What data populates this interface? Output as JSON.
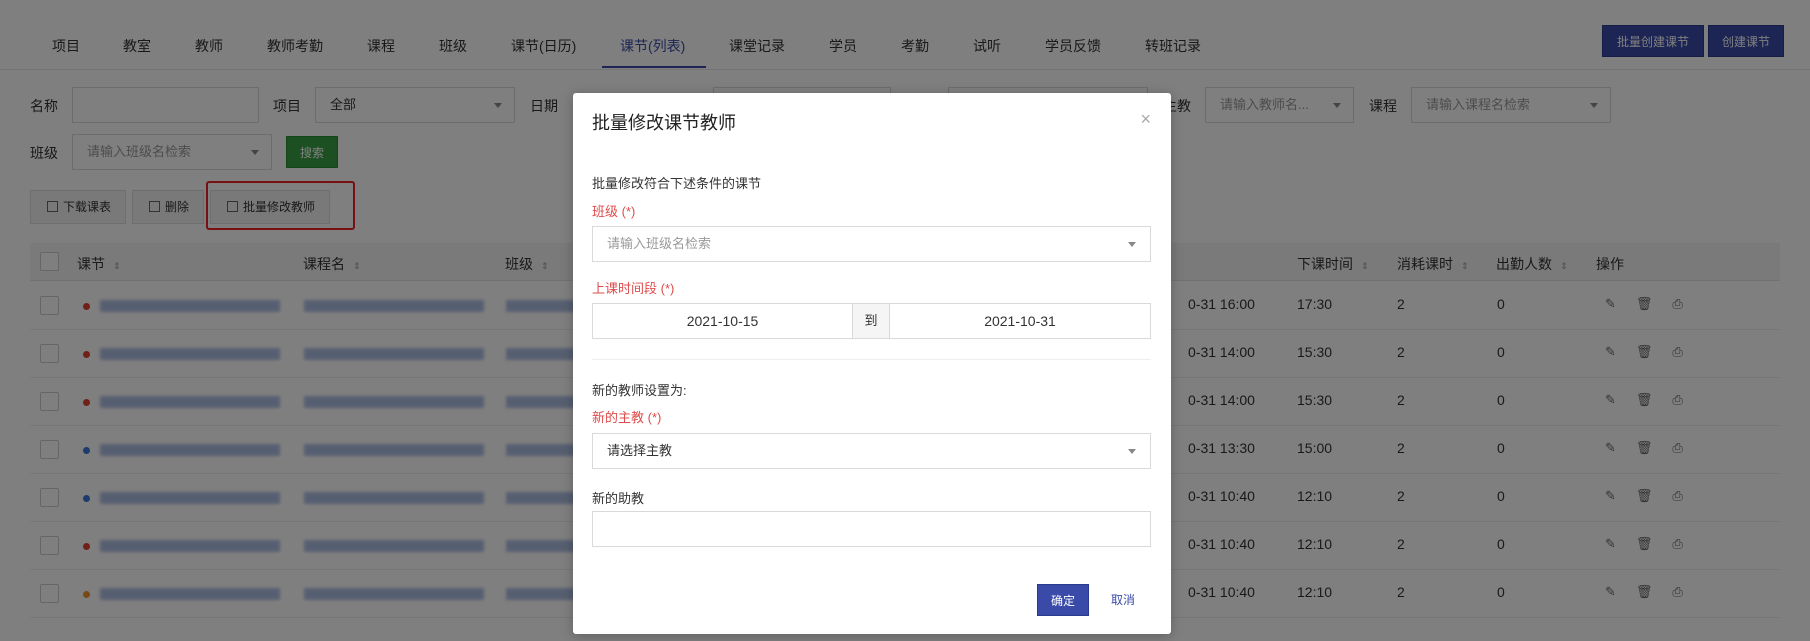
{
  "nav": {
    "tabs": [
      "项目",
      "教室",
      "教师",
      "教师考勤",
      "课程",
      "班级",
      "课节(日历)",
      "课节(列表)",
      "课堂记录",
      "学员",
      "考勤",
      "试听",
      "学员反馈",
      "转班记录"
    ],
    "active_index": 7,
    "batch_create_label": "批量创建课节",
    "create_label": "创建课节"
  },
  "filters": {
    "name_label": "名称",
    "name_value": "",
    "project_label": "项目",
    "project_value": "全部",
    "date_label": "日期",
    "teacher_label_suffix": "主教",
    "teacher_placeholder": "请输入教师名...",
    "course_label": "课程",
    "course_placeholder": "请输入课程名检索",
    "class_label": "班级",
    "class_placeholder": "请输入班级名检索",
    "search_label": "搜索"
  },
  "actions": {
    "download_label": "下载课表",
    "delete_label": "删除",
    "batch_teacher_label": "批量修改教师"
  },
  "table": {
    "headers": {
      "lesson": "课节",
      "course": "课程名",
      "class": "班级",
      "end_time": "下课时间",
      "hours": "消耗课时",
      "attendance": "出勤人数",
      "ops": "操作"
    },
    "rows": [
      {
        "dot": "#e0412f",
        "start": "0-31 16:00",
        "end": "17:30",
        "hours": "2",
        "attendance": "0"
      },
      {
        "dot": "#e0412f",
        "start": "0-31 14:00",
        "end": "15:30",
        "hours": "2",
        "attendance": "0"
      },
      {
        "dot": "#e0412f",
        "start": "0-31 14:00",
        "end": "15:30",
        "hours": "2",
        "attendance": "0"
      },
      {
        "dot": "#3a78d8",
        "start": "0-31 13:30",
        "end": "15:00",
        "hours": "2",
        "attendance": "0"
      },
      {
        "dot": "#3a78d8",
        "start": "0-31 10:40",
        "end": "12:10",
        "hours": "2",
        "attendance": "0"
      },
      {
        "dot": "#e0412f",
        "start": "0-31 10:40",
        "end": "12:10",
        "hours": "2",
        "attendance": "0"
      },
      {
        "dot": "#f0922e",
        "start": "0-31 10:40",
        "end": "12:10",
        "hours": "2",
        "attendance": "0"
      }
    ]
  },
  "modal": {
    "title": "批量修改课节教师",
    "subtitle": "批量修改符合下述条件的课节",
    "class_label": "班级 (*)",
    "class_placeholder": "请输入班级名检索",
    "period_label": "上课时间段 (*)",
    "date_from": "2021-10-15",
    "to_label": "到",
    "date_to": "2021-10-31",
    "new_teacher_heading": "新的教师设置为:",
    "new_main_label": "新的主教 (*)",
    "new_main_placeholder": "请选择主教",
    "new_assistant_label": "新的助教",
    "new_assistant_value": "",
    "ok_label": "确定",
    "cancel_label": "取消"
  }
}
